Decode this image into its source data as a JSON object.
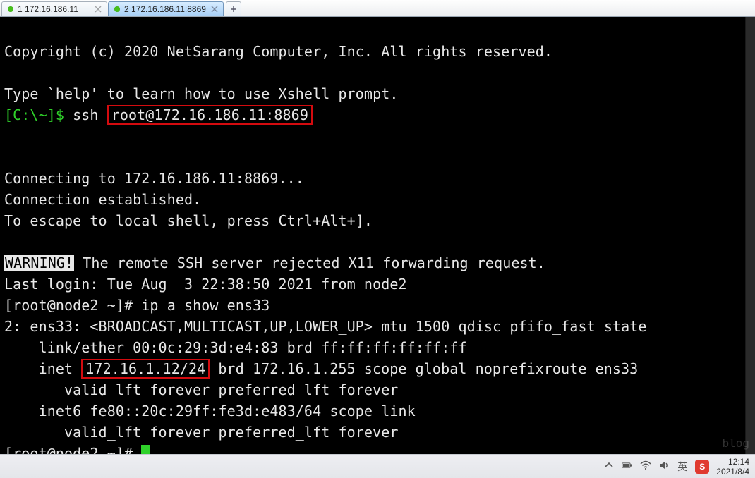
{
  "tabs": [
    {
      "index": "1",
      "label": "172.16.186.11",
      "active": false
    },
    {
      "index": "2",
      "label": "172.16.186.11:8869",
      "active": true
    }
  ],
  "term": {
    "copyright": "Copyright (c) 2020 NetSarang Computer, Inc. All rights reserved.",
    "help_line": "Type `help' to learn how to use Xshell prompt.",
    "prompt_local": "[C:\\~]$ ",
    "ssh_cmd_prefix": "ssh ",
    "ssh_target": "root@172.16.186.11:8869",
    "connecting": "Connecting to 172.16.186.11:8869...",
    "established": "Connection established.",
    "escape": "To escape to local shell, press Ctrl+Alt+].",
    "warning_badge": "WARNING!",
    "warning_text": " The remote SSH server rejected X11 forwarding request.",
    "last_login": "Last login: Tue Aug  3 22:38:50 2021 from node2",
    "prompt_remote": "[root@node2 ~]# ",
    "cmd1": "ip a show ens33",
    "if_line1": "2: ens33: <BROADCAST,MULTICAST,UP,LOWER_UP> mtu 1500 qdisc pfifo_fast state ",
    "if_line2": "    link/ether 00:0c:29:3d:e4:83 brd ff:ff:ff:ff:ff:ff",
    "inet_prefix": "    inet ",
    "inet_hl": "172.16.1.12/24",
    "inet_suffix": " brd 172.16.1.255 scope global noprefixroute ens33",
    "valid1": "       valid_lft forever preferred_lft forever",
    "inet6": "    inet6 fe80::20c:29ff:fe3d:e483/64 scope link ",
    "valid2": "       valid_lft forever preferred_lft forever"
  },
  "taskbar": {
    "ime_lang": "英",
    "ime_badge": "S",
    "time": "12:14",
    "date": "2021/8/4"
  },
  "watermark": "blog"
}
